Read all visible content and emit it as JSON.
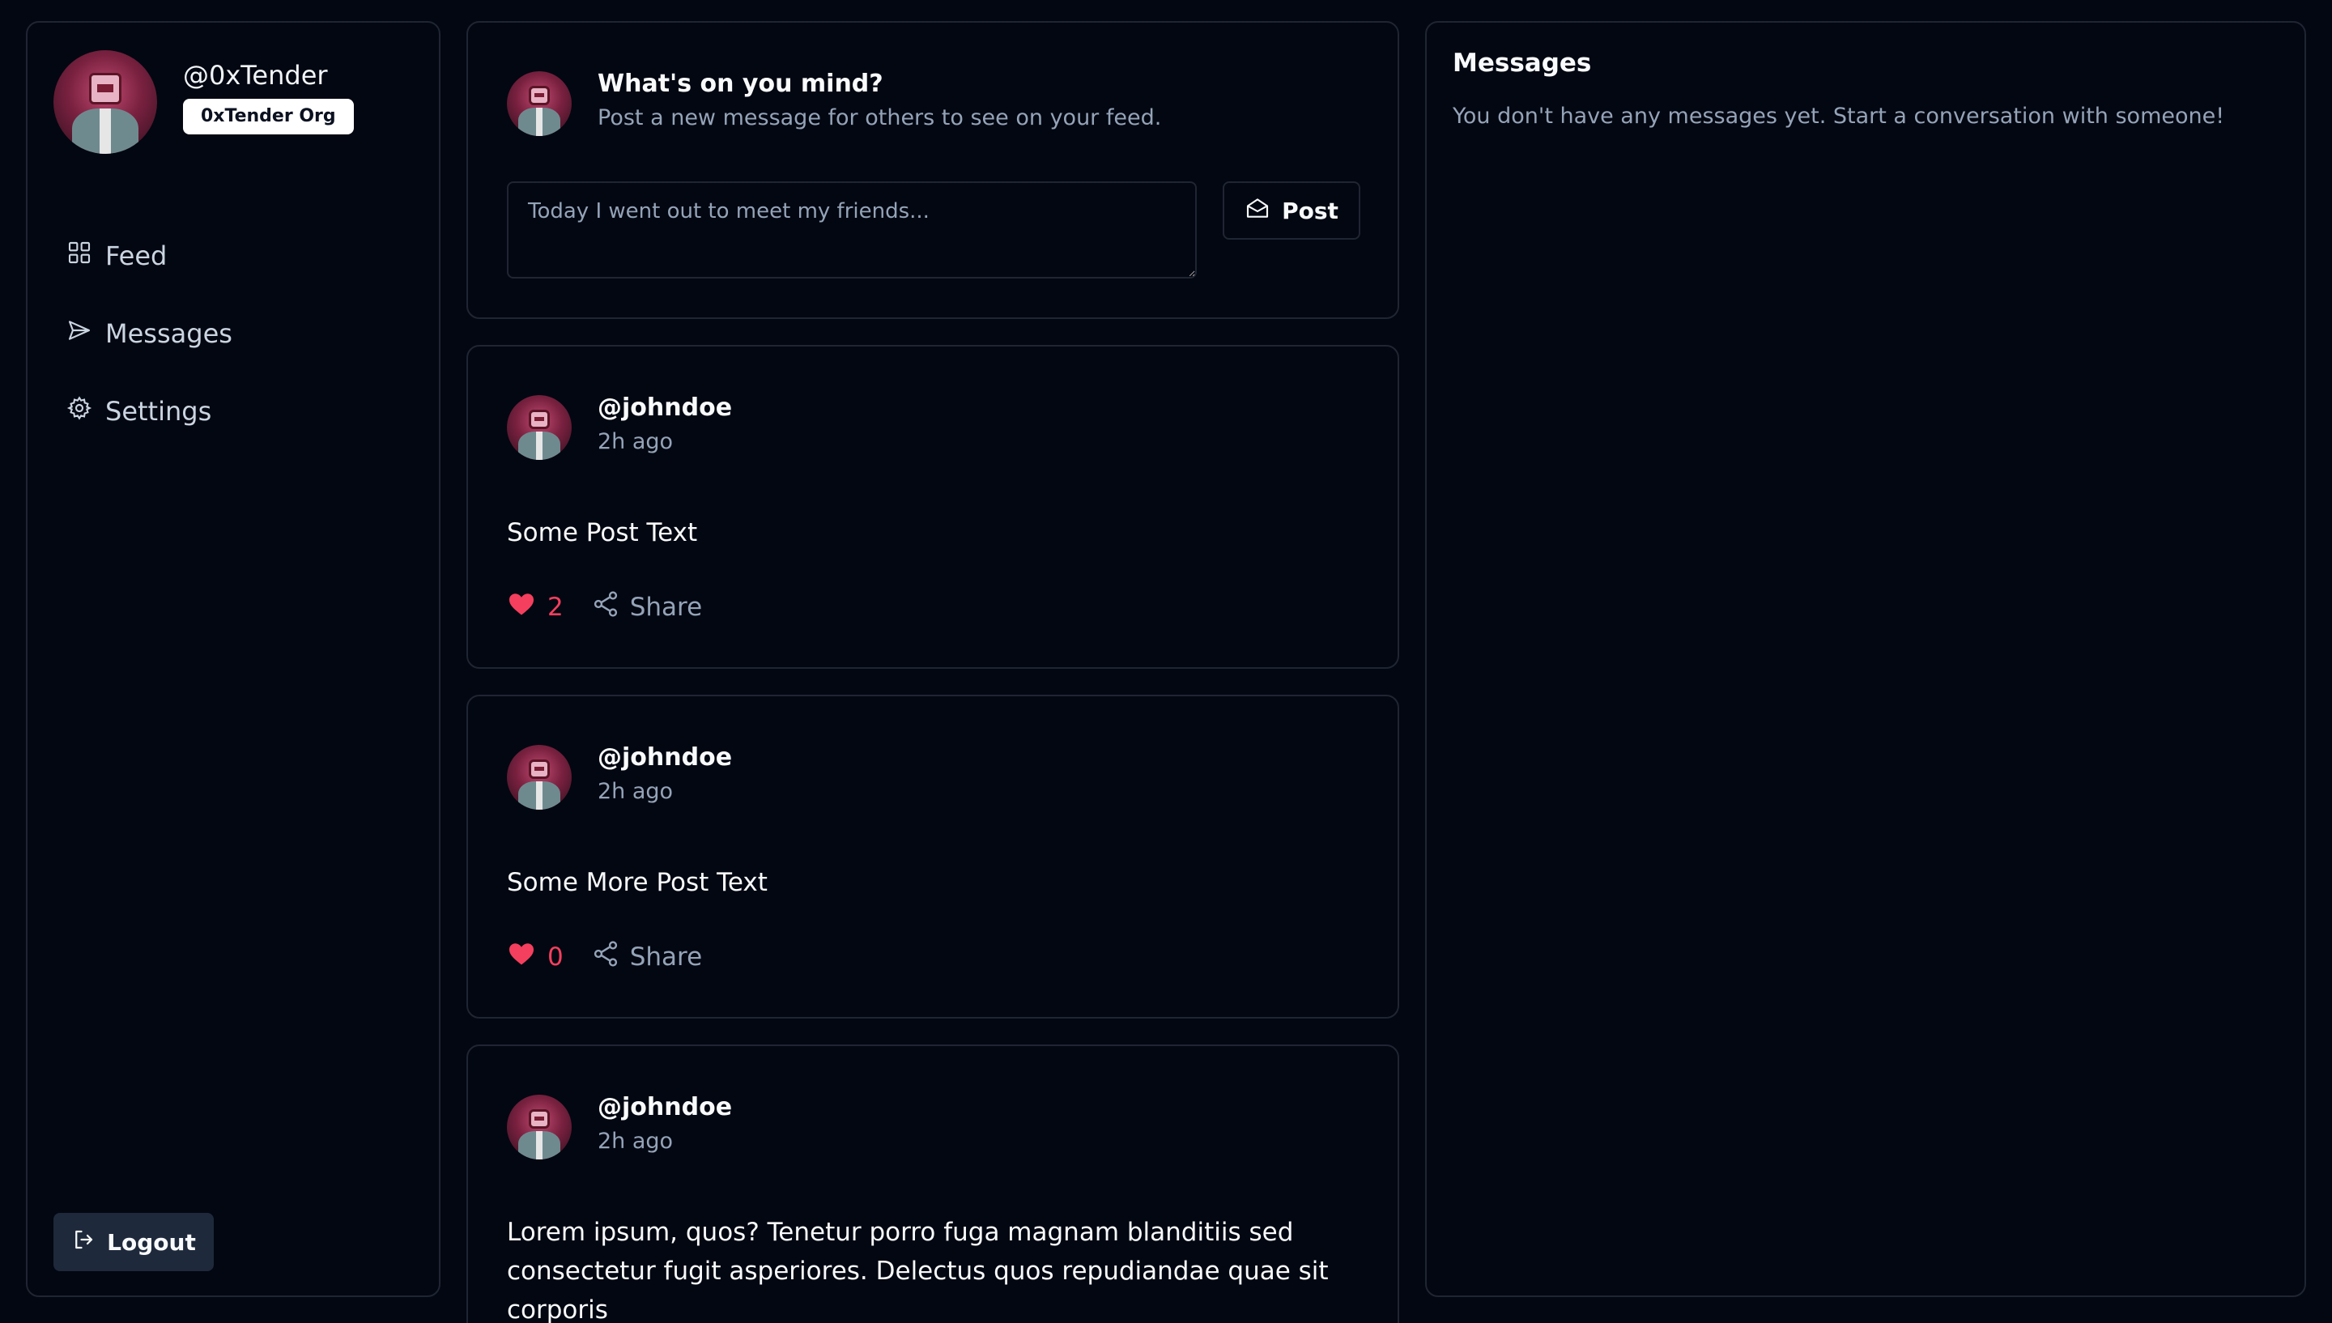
{
  "sidebar": {
    "profile": {
      "username": "@0xTender",
      "org": "0xTender Org"
    },
    "nav": [
      {
        "label": "Feed",
        "icon": "grid-icon"
      },
      {
        "label": "Messages",
        "icon": "send-icon"
      },
      {
        "label": "Settings",
        "icon": "gear-icon"
      }
    ],
    "logout_label": "Logout"
  },
  "composer": {
    "title": "What's on you mind?",
    "subtitle": "Post a new message for others to see on your feed.",
    "placeholder": "Today I went out to meet my friends...",
    "post_label": "Post"
  },
  "posts": [
    {
      "author": "@johndoe",
      "time": "2h ago",
      "text": "Some Post Text",
      "likes": "2",
      "share_label": "Share"
    },
    {
      "author": "@johndoe",
      "time": "2h ago",
      "text": "Some More Post Text",
      "likes": "0",
      "share_label": "Share"
    },
    {
      "author": "@johndoe",
      "time": "2h ago",
      "text": "Lorem ipsum, quos? Tenetur porro fuga magnam blanditiis sed consectetur fugit asperiores. Delectus quos repudiandae quae sit corporis"
    }
  ],
  "messages": {
    "title": "Messages",
    "empty_text": "You don't have any messages yet. Start a conversation with someone!"
  },
  "colors": {
    "background": "#030711",
    "border": "#1f2533",
    "like": "#f43f5e",
    "muted": "#94a3b8"
  }
}
